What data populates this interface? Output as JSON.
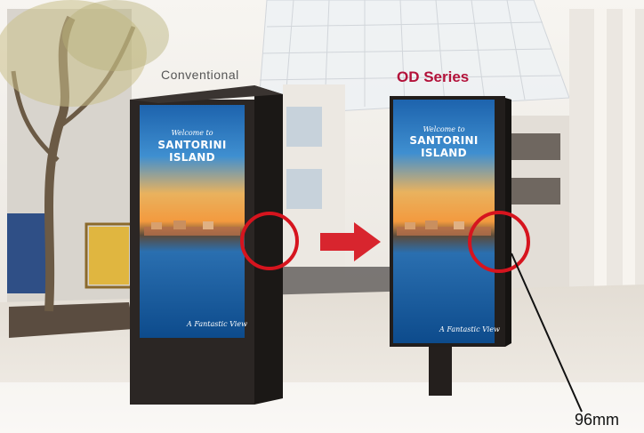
{
  "labels": {
    "conventional": "Conventional",
    "od_series": "OD Series",
    "bezel_measure": "96mm"
  },
  "screen": {
    "welcome": "Welcome to",
    "title_line1": "SANTORINI",
    "title_line2": "ISLAND",
    "footer": "A Fantastic View"
  },
  "colors": {
    "accent": "#b3123a",
    "highlight_ring": "#d6141e",
    "arrow": "#d6141e",
    "kiosk": "#231f1d"
  }
}
